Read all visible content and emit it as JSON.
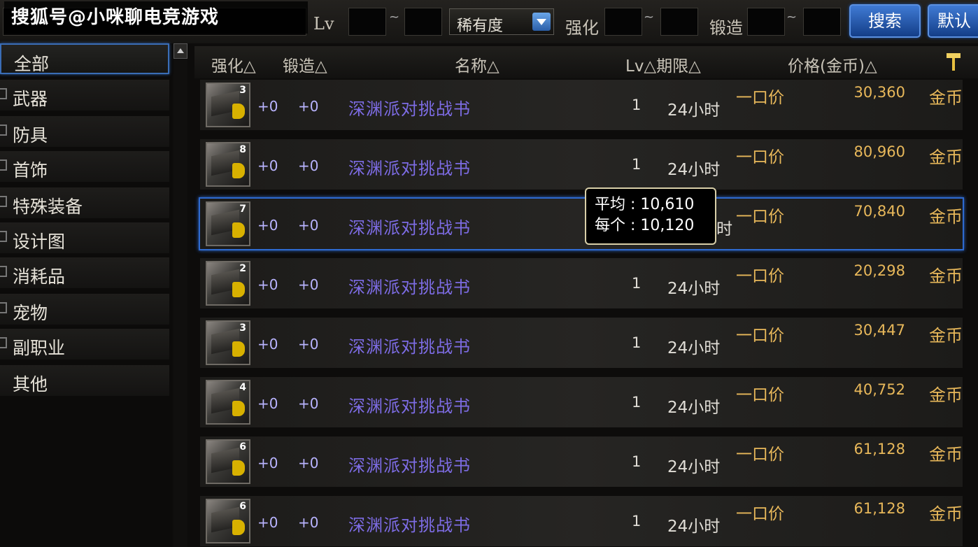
{
  "watermark": "搜狐号@小咪聊电竞游戏",
  "search": {
    "lv_label": "Lv",
    "rarity_label": "稀有度",
    "strengthen_label": "强化",
    "forge_label": "锻造",
    "search_button": "搜索",
    "default_button": "默认",
    "tilde": "~"
  },
  "categories": [
    {
      "label": "全部",
      "selected": true
    },
    {
      "label": "武器"
    },
    {
      "label": "防具"
    },
    {
      "label": "首饰"
    },
    {
      "label": "特殊装备"
    },
    {
      "label": "设计图"
    },
    {
      "label": "消耗品"
    },
    {
      "label": "宠物"
    },
    {
      "label": "副职业"
    },
    {
      "label": "其他"
    }
  ],
  "columns": {
    "strengthen": "强化△",
    "forge": "锻造△",
    "name": "名称△",
    "lv_period": "Lv△期限△",
    "price": "价格(金币)△"
  },
  "rows": [
    {
      "count": "3",
      "str": "+0",
      "forge": "+0",
      "name": "深渊派对挑战书",
      "lv": "1",
      "period": "24小时",
      "type": "一口价",
      "price": "30,360",
      "currency": "金币"
    },
    {
      "count": "8",
      "str": "+0",
      "forge": "+0",
      "name": "深渊派对挑战书",
      "lv": "1",
      "period": "24小时",
      "type": "一口价",
      "price": "80,960",
      "currency": "金币"
    },
    {
      "count": "7",
      "str": "+0",
      "forge": "+0",
      "name": "深渊派对挑战书",
      "lv": "",
      "period": "时",
      "type": "一口价",
      "price": "70,840",
      "currency": "金币"
    },
    {
      "count": "2",
      "str": "+0",
      "forge": "+0",
      "name": "深渊派对挑战书",
      "lv": "1",
      "period": "24小时",
      "type": "一口价",
      "price": "20,298",
      "currency": "金币"
    },
    {
      "count": "3",
      "str": "+0",
      "forge": "+0",
      "name": "深渊派对挑战书",
      "lv": "1",
      "period": "24小时",
      "type": "一口价",
      "price": "30,447",
      "currency": "金币"
    },
    {
      "count": "4",
      "str": "+0",
      "forge": "+0",
      "name": "深渊派对挑战书",
      "lv": "1",
      "period": "24小时",
      "type": "一口价",
      "price": "40,752",
      "currency": "金币"
    },
    {
      "count": "6",
      "str": "+0",
      "forge": "+0",
      "name": "深渊派对挑战书",
      "lv": "1",
      "period": "24小时",
      "type": "一口价",
      "price": "61,128",
      "currency": "金币"
    },
    {
      "count": "6",
      "str": "+0",
      "forge": "+0",
      "name": "深渊派对挑战书",
      "lv": "1",
      "period": "24小时",
      "type": "一口价",
      "price": "61,128",
      "currency": "金币"
    }
  ],
  "tooltip": {
    "avg": "平均 : 10,610",
    "each": "每个 : 10,120"
  },
  "colors": {
    "accent_blue": "#2e6ad0",
    "item_purple": "#7d6ce4",
    "gold_text": "#e8b85a"
  }
}
